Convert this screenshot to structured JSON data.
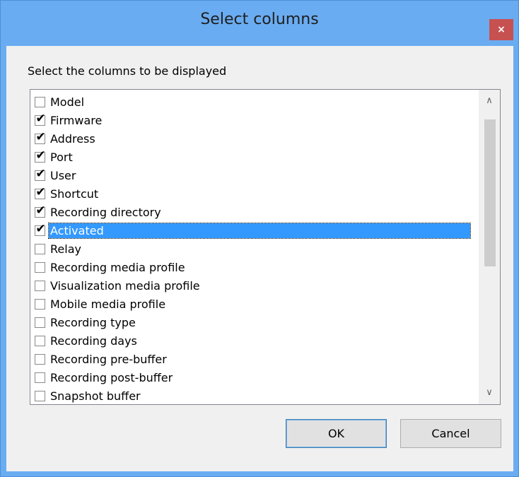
{
  "window": {
    "title": "Select columns",
    "close_glyph": "×"
  },
  "dialog": {
    "prompt": "Select the columns to be displayed",
    "items": [
      {
        "label": "Model",
        "checked": false,
        "selected": false
      },
      {
        "label": "Firmware",
        "checked": true,
        "selected": false
      },
      {
        "label": "Address",
        "checked": true,
        "selected": false
      },
      {
        "label": "Port",
        "checked": true,
        "selected": false
      },
      {
        "label": "User",
        "checked": true,
        "selected": false
      },
      {
        "label": "Shortcut",
        "checked": true,
        "selected": false
      },
      {
        "label": "Recording directory",
        "checked": true,
        "selected": false
      },
      {
        "label": "Activated",
        "checked": true,
        "selected": true
      },
      {
        "label": "Relay",
        "checked": false,
        "selected": false
      },
      {
        "label": "Recording media profile",
        "checked": false,
        "selected": false
      },
      {
        "label": "Visualization media profile",
        "checked": false,
        "selected": false
      },
      {
        "label": "Mobile media profile",
        "checked": false,
        "selected": false
      },
      {
        "label": "Recording type",
        "checked": false,
        "selected": false
      },
      {
        "label": "Recording days",
        "checked": false,
        "selected": false
      },
      {
        "label": "Recording pre-buffer",
        "checked": false,
        "selected": false
      },
      {
        "label": "Recording post-buffer",
        "checked": false,
        "selected": false
      },
      {
        "label": "Snapshot buffer",
        "checked": false,
        "selected": false
      }
    ],
    "scroll_up_glyph": "∧",
    "scroll_down_glyph": "∨",
    "ok_label": "OK",
    "cancel_label": "Cancel"
  },
  "colors": {
    "title_bar": "#6aacf1",
    "close_button": "#c75050",
    "selection": "#3399ff"
  }
}
